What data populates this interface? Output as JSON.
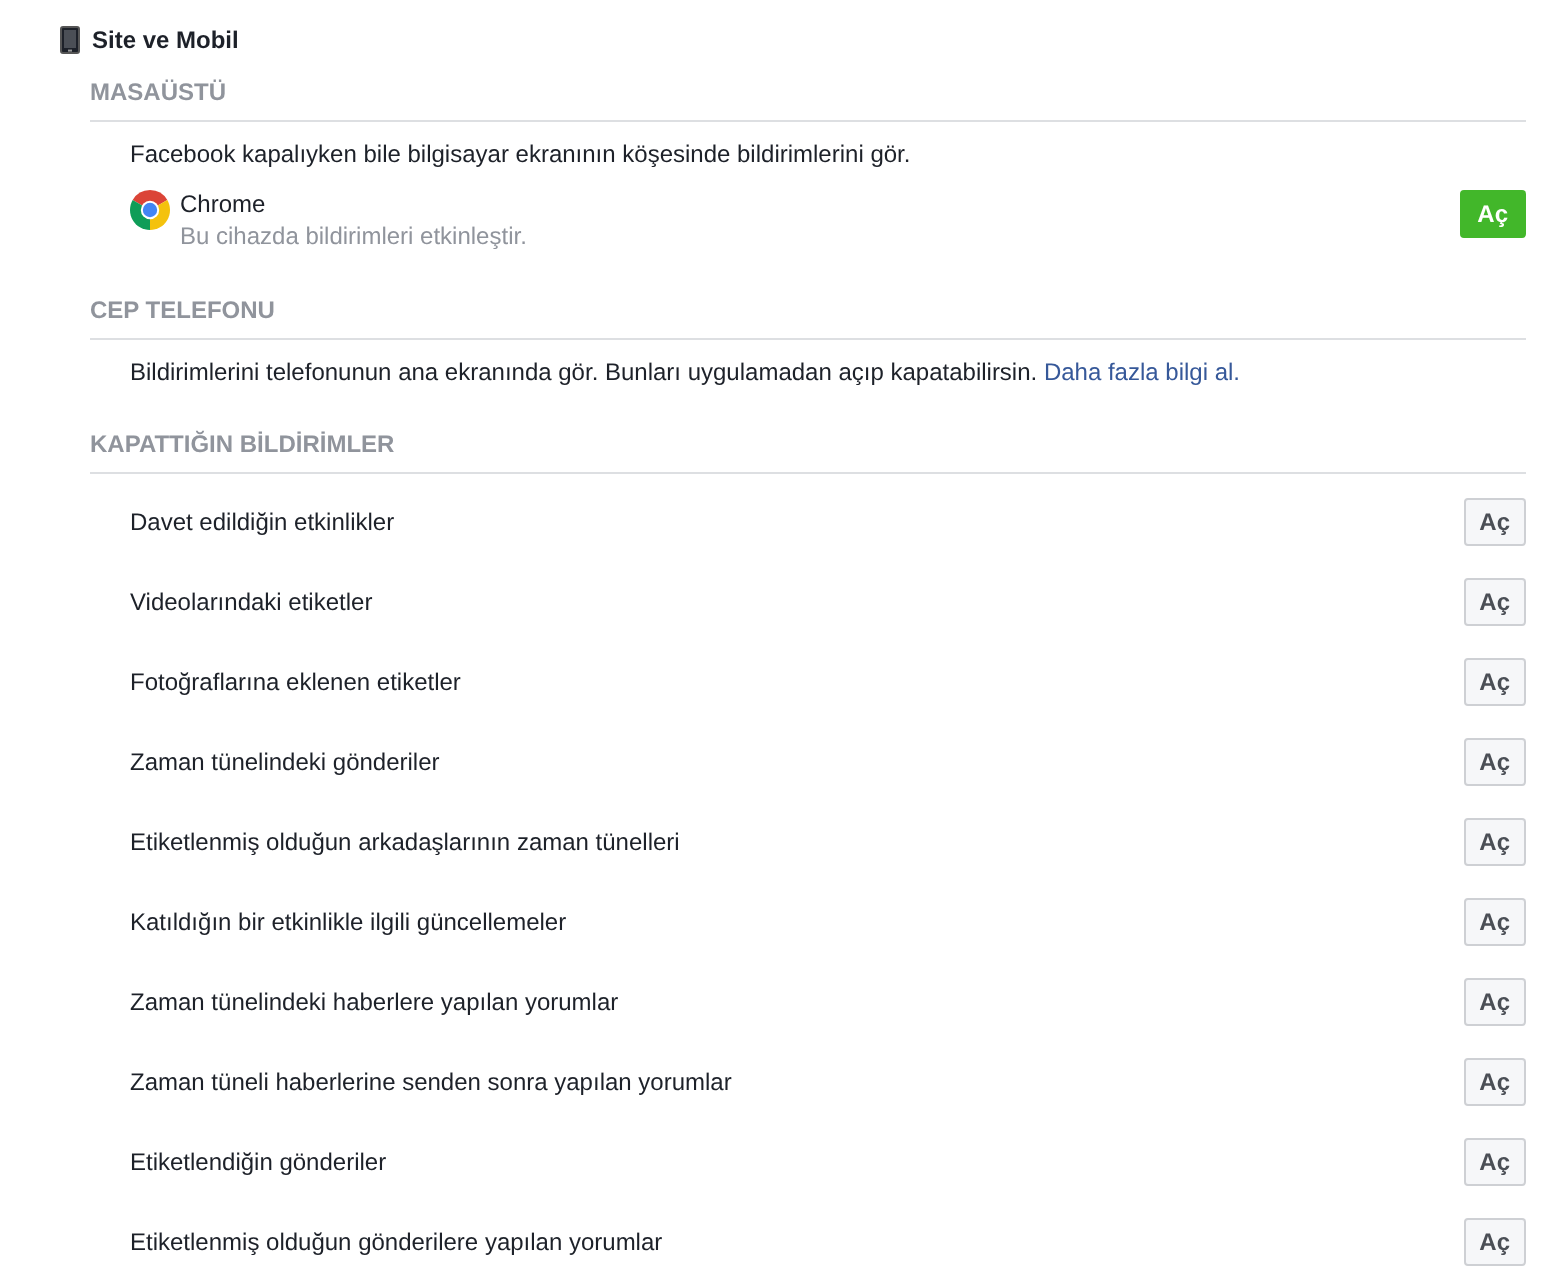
{
  "header": {
    "title": "Site ve Mobil"
  },
  "desktop": {
    "heading": "MASAÜSTÜ",
    "description": "Facebook kapalıyken bile bilgisayar ekranının köşesinde bildirimlerini gör.",
    "browser": {
      "name": "Chrome",
      "subtitle": "Bu cihazda bildirimleri etkinleştir.",
      "button": "Aç"
    }
  },
  "mobile": {
    "heading": "CEP TELEFONU",
    "description": "Bildirimlerini telefonunun ana ekranında gör. Bunları uygulamadan açıp kapatabilirsin.",
    "link": "Daha fazla bilgi al."
  },
  "turned_off": {
    "heading": "KAPATTIĞIN BİLDİRİMLER",
    "items": [
      {
        "label": "Davet edildiğin etkinlikler",
        "button": "Aç"
      },
      {
        "label": "Videolarındaki etiketler",
        "button": "Aç"
      },
      {
        "label": "Fotoğraflarına eklenen etiketler",
        "button": "Aç"
      },
      {
        "label": "Zaman tünelindeki gönderiler",
        "button": "Aç"
      },
      {
        "label": "Etiketlenmiş olduğun arkadaşlarının zaman tünelleri",
        "button": "Aç"
      },
      {
        "label": "Katıldığın bir etkinlikle ilgili güncellemeler",
        "button": "Aç"
      },
      {
        "label": "Zaman tünelindeki haberlere yapılan yorumlar",
        "button": "Aç"
      },
      {
        "label": "Zaman tüneli haberlerine senden sonra yapılan yorumlar",
        "button": "Aç"
      },
      {
        "label": "Etiketlendiğin gönderiler",
        "button": "Aç"
      },
      {
        "label": "Etiketlenmiş olduğun gönderilere yapılan yorumlar",
        "button": "Aç"
      }
    ]
  }
}
